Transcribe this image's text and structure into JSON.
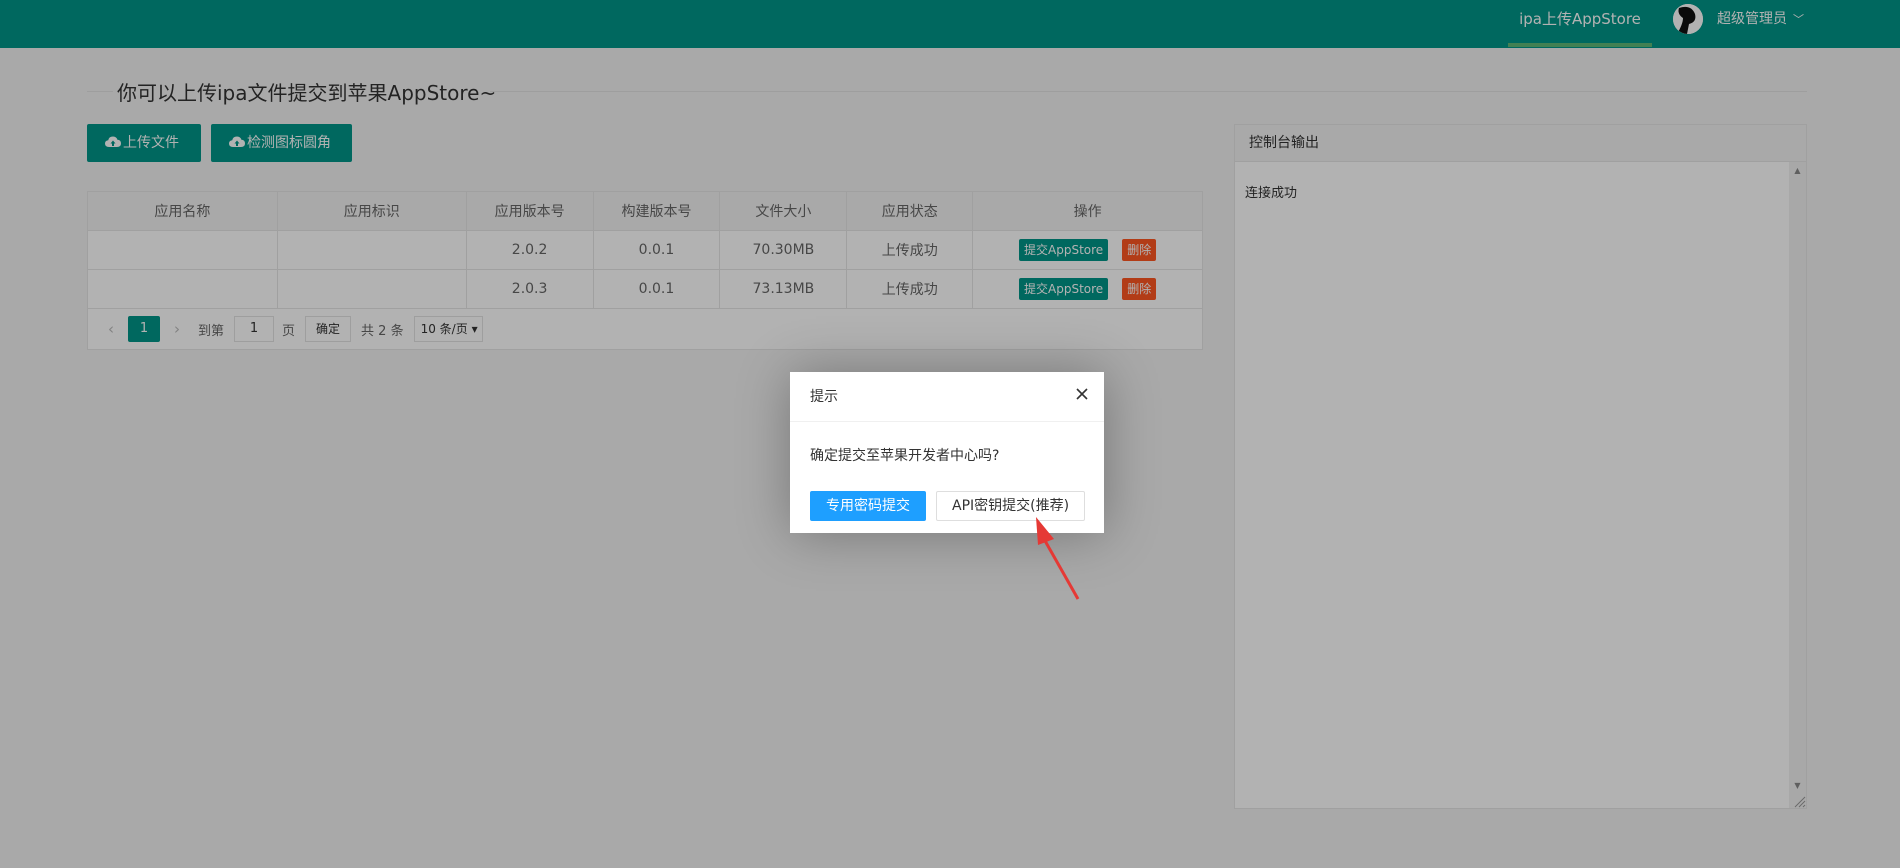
{
  "header": {
    "nav_item": "ipa上传AppStore",
    "user_name": "超级管理员",
    "user_chevron": "﹀",
    "colors": {
      "primary": "#009688",
      "active_underline": "#5FB878"
    }
  },
  "page": {
    "title": "你可以上传ipa文件提交到苹果AppStore~"
  },
  "toolbar": {
    "upload_label": "上传文件",
    "check_label": "检测图标圆角",
    "icon": "cloud-upload-icon"
  },
  "table": {
    "headers": [
      "应用名称",
      "应用标识",
      "应用版本号",
      "构建版本号",
      "文件大小",
      "应用状态",
      "操作"
    ],
    "rows": [
      {
        "name": "  ",
        "bundle": " ",
        "version": "2.0.2",
        "build": "0.0.1",
        "size": "70.30MB",
        "status": "上传成功"
      },
      {
        "name": "  ",
        "bundle": " ",
        "version": "2.0.3",
        "build": "0.0.1",
        "size": "73.13MB",
        "status": "上传成功"
      }
    ],
    "actions": {
      "submit": "提交AppStore",
      "delete": "删除"
    },
    "status_colors": {
      "submit": "#009688",
      "delete": "#FF5722"
    }
  },
  "pager": {
    "prev": "‹",
    "current": "1",
    "next": "›",
    "goto_label": "到第",
    "goto_value": "1",
    "page_unit": "页",
    "ok_label": "确定",
    "total_text": "共 2 条",
    "per_page": "10 条/页"
  },
  "console": {
    "title": "控制台输出",
    "output": "连接成功"
  },
  "dialog": {
    "title": "提示",
    "message": "确定提交至苹果开发者中心吗?",
    "btn_primary": "专用密码提交",
    "btn_secondary": "API密钥提交(推荐)",
    "colors": {
      "primary_button": "#1E9FFF"
    }
  },
  "annotation": {
    "arrow_color": "#E53935"
  }
}
